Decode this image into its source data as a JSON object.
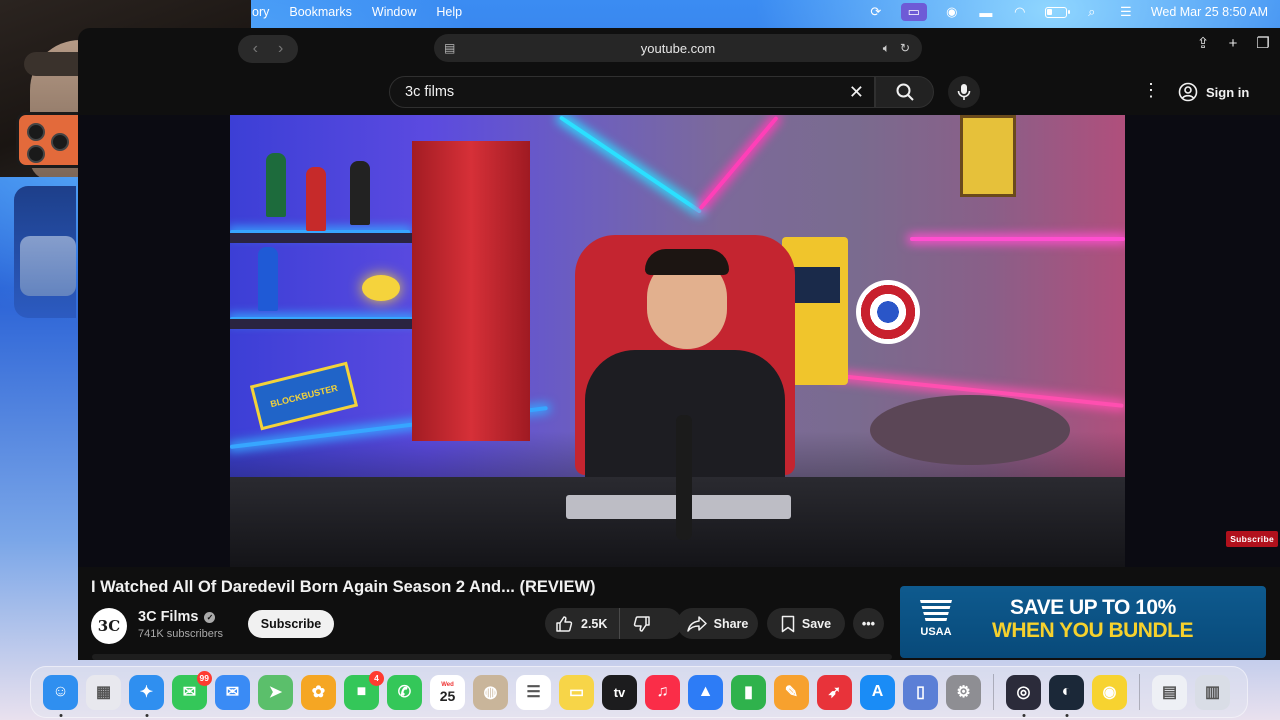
{
  "menubar": {
    "menus": [
      "ory",
      "Bookmarks",
      "Window",
      "Help"
    ],
    "datetime": "Wed Mar 25  8:50 AM"
  },
  "browser": {
    "url": "youtube.com"
  },
  "youtube": {
    "search_value": "3c films",
    "sign_in": "Sign in",
    "video": {
      "title": "I Watched All Of Daredevil Born Again Season 2 And... (REVIEW)",
      "watermark": "Subscribe",
      "sign_text": "BLOCKBUSTER"
    },
    "channel": {
      "avatar_text": "3C",
      "name": "3C Films",
      "subscribers": "741K subscribers",
      "subscribe_label": "Subscribe"
    },
    "actions": {
      "likes": "2.5K",
      "share": "Share",
      "save": "Save"
    },
    "ad": {
      "brand": "USAA",
      "line1": "SAVE UP TO 10%",
      "line2": "WHEN YOU BUNDLE"
    }
  },
  "dock": {
    "apps": [
      {
        "name": "finder-icon",
        "color": "#2f8ff0"
      },
      {
        "name": "launchpad-icon",
        "color": "#e8e8ee"
      },
      {
        "name": "safari-icon",
        "color": "#2f8ff0"
      },
      {
        "name": "messages-icon",
        "color": "#34c759",
        "badge": "99"
      },
      {
        "name": "mail-icon",
        "color": "#3a8bf5"
      },
      {
        "name": "maps-icon",
        "color": "#5bbf6b"
      },
      {
        "name": "photos-icon",
        "color": "#f5a623"
      },
      {
        "name": "facetime-icon",
        "color": "#34c759",
        "badge": "4"
      },
      {
        "name": "phone-icon",
        "color": "#34c759"
      },
      {
        "name": "calendar-icon",
        "color": "#ffffff",
        "day": "Wed",
        "date": "25"
      },
      {
        "name": "contacts-icon",
        "color": "#c9b59a"
      },
      {
        "name": "reminders-icon",
        "color": "#ffffff"
      },
      {
        "name": "notes-icon",
        "color": "#f7d548"
      },
      {
        "name": "tv-icon",
        "color": "#1c1c1e",
        "label": "tv"
      },
      {
        "name": "music-icon",
        "color": "#fa2d48"
      },
      {
        "name": "keynote-icon",
        "color": "#2d7cf6"
      },
      {
        "name": "numbers-icon",
        "color": "#2fb24c"
      },
      {
        "name": "pages-icon",
        "color": "#f7a12e"
      },
      {
        "name": "rocket-icon",
        "color": "#e8333a"
      },
      {
        "name": "app-store-icon",
        "color": "#1a8cf6"
      },
      {
        "name": "preview-icon",
        "color": "#5b7fd6"
      },
      {
        "name": "system-settings-icon",
        "color": "#8e8e93"
      },
      {
        "name": "obs-icon",
        "color": "#2b2b3a"
      },
      {
        "name": "steam-icon",
        "color": "#1b2838"
      },
      {
        "name": "tips-icon",
        "color": "#f7d330"
      },
      {
        "name": "downloads-icon",
        "color": "#eef0f5"
      },
      {
        "name": "trash-icon",
        "color": "#d9dde6"
      }
    ]
  }
}
